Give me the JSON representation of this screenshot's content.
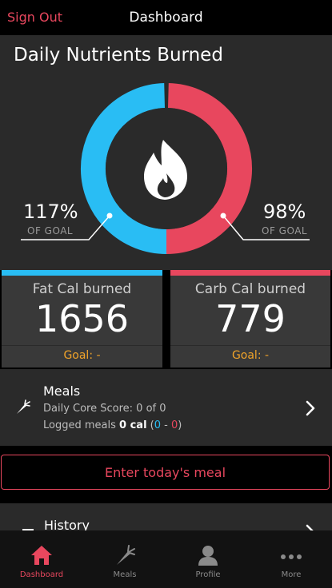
{
  "header": {
    "sign_out": "Sign Out",
    "title": "Dashboard"
  },
  "nutrients": {
    "title": "Daily Nutrients Burned",
    "fat": {
      "pct": "117%",
      "caption": "OF GOAL",
      "color": "#29bdf4"
    },
    "carb": {
      "pct": "98%",
      "caption": "OF GOAL",
      "color": "#e8475e"
    },
    "center_icon": "flame-icon"
  },
  "stats": {
    "fat": {
      "label": "Fat Cal burned",
      "value": "1656",
      "goal": "Goal: -"
    },
    "carb": {
      "label": "Carb Cal burned",
      "value": "779",
      "goal": "Goal: -"
    }
  },
  "meals": {
    "title": "Meals",
    "score": "Daily Core Score: 0 of 0",
    "logged_prefix": "Logged meals",
    "logged_cal": "0 cal",
    "open_paren": "(",
    "fat_count": "0",
    "dash": "-",
    "carb_count": "0",
    "close_paren": ")",
    "icon": "carrot-icon"
  },
  "enter_button": "Enter today's meal",
  "history": {
    "title": "History"
  },
  "tabs": [
    {
      "label": "Dashboard",
      "icon": "home-icon",
      "active": true
    },
    {
      "label": "Meals",
      "icon": "carrot-icon",
      "active": false
    },
    {
      "label": "Profile",
      "icon": "person-icon",
      "active": false
    },
    {
      "label": "More",
      "icon": "more-icon",
      "active": false
    }
  ],
  "colors": {
    "accent": "#e8475e",
    "fat": "#29bdf4",
    "goal": "#f0a32a"
  }
}
